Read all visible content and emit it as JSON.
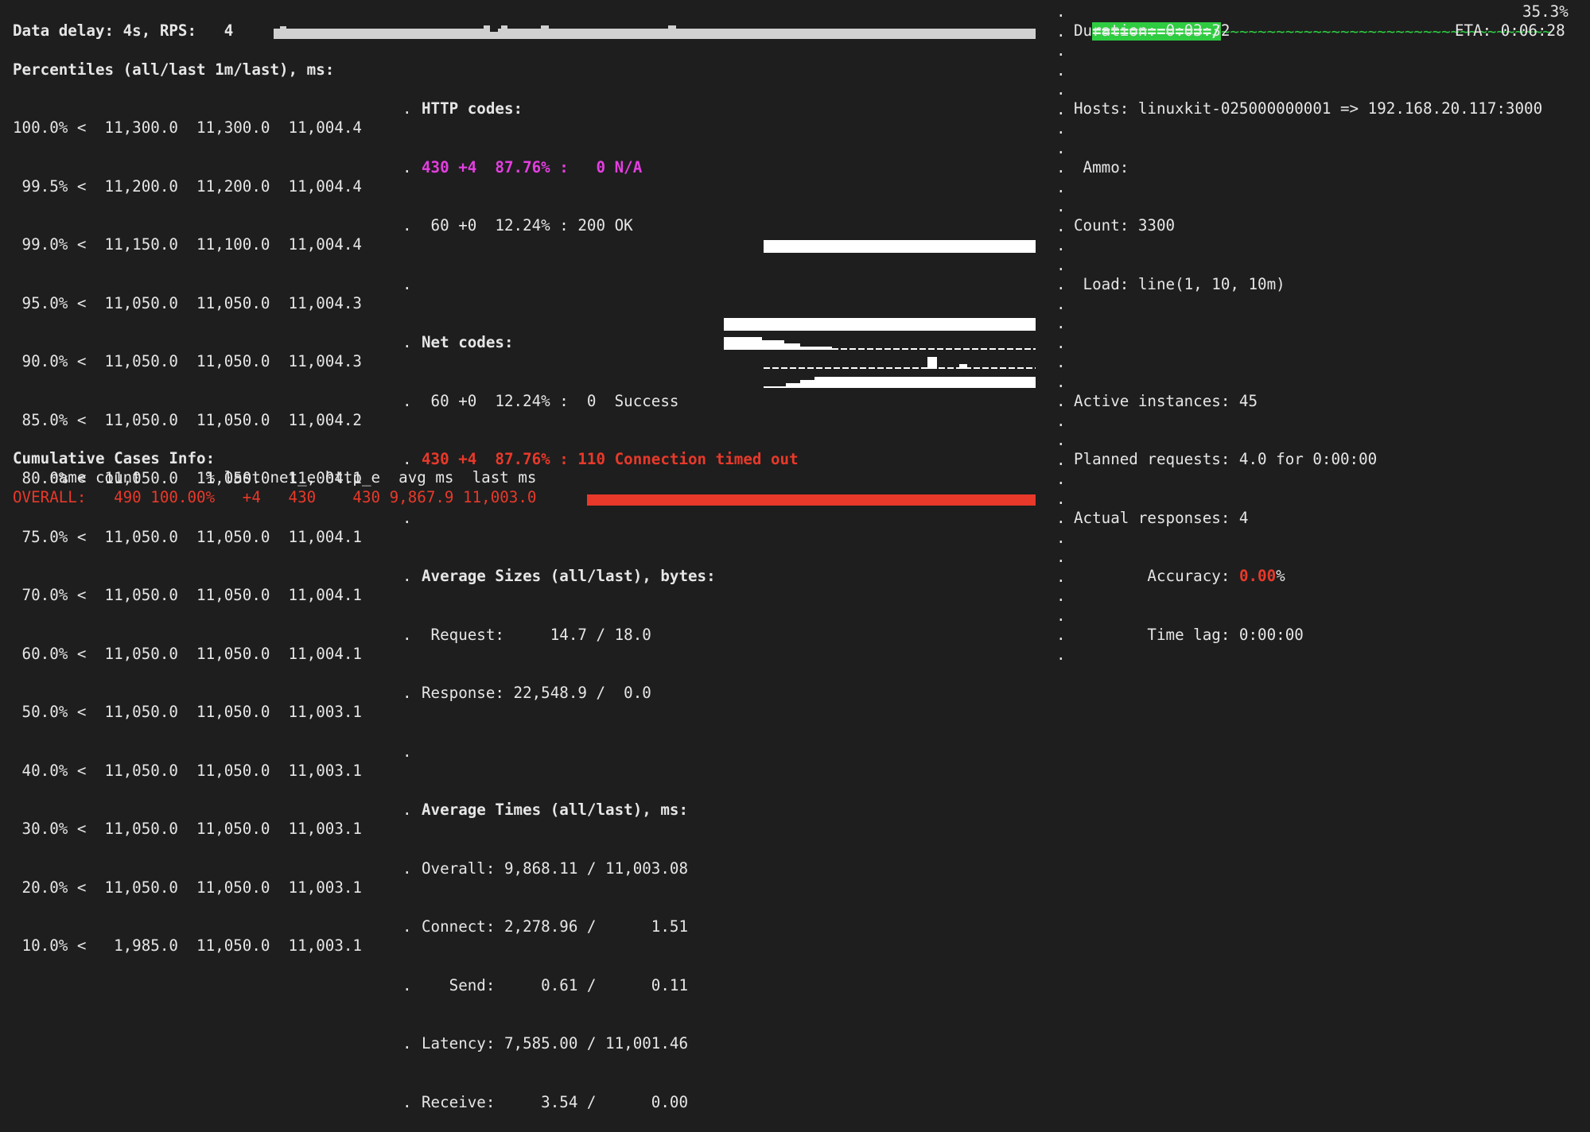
{
  "header": {
    "data_delay_line": "Data delay: 4s, RPS:   4"
  },
  "percentiles": {
    "title": "Percentiles (all/last 1m/last), ms:",
    "rows": [
      "100.0% <  11,300.0  11,300.0  11,004.4",
      " 99.5% <  11,200.0  11,200.0  11,004.4",
      " 99.0% <  11,150.0  11,100.0  11,004.4",
      " 95.0% <  11,050.0  11,050.0  11,004.3",
      " 90.0% <  11,050.0  11,050.0  11,004.3",
      " 85.0% <  11,050.0  11,050.0  11,004.2",
      " 80.0% <  11,050.0  11,050.0  11,004.1",
      " 75.0% <  11,050.0  11,050.0  11,004.1",
      " 70.0% <  11,050.0  11,050.0  11,004.1",
      " 60.0% <  11,050.0  11,050.0  11,004.1",
      " 50.0% <  11,050.0  11,050.0  11,003.1",
      " 40.0% <  11,050.0  11,050.0  11,003.1",
      " 30.0% <  11,050.0  11,050.0  11,003.1",
      " 20.0% <  11,050.0  11,050.0  11,003.1",
      " 10.0% <   1,985.0  11,050.0  11,003.1"
    ]
  },
  "http_codes": {
    "title": "HTTP codes:",
    "row1": "430 +4  87.76% :   0 N/A",
    "row2": " 60 +0  12.24% : 200 OK"
  },
  "net_codes": {
    "title": "Net codes:",
    "row1": " 60 +0  12.24% :  0  Success",
    "row2": "430 +4  87.76% : 110 Connection timed out"
  },
  "avg_sizes": {
    "title": "Average Sizes (all/last), bytes:",
    "request": " Request:     14.7 / 18.0",
    "response": "Response: 22,548.9 /  0.0"
  },
  "avg_times": {
    "title": "Average Times (all/last), ms:",
    "overall": "Overall: 9,868.11 / 11,003.08",
    "connect": "Connect: 2,278.96 /      1.51",
    "send": "   Send:     0.61 /      0.11",
    "latency": "Latency: 7,585.00 / 11,001.46",
    "receive": "Receive:     3.54 /      0.00"
  },
  "cases": {
    "title": "Cumulative Cases Info:",
    "header": "    name count       % last net_e http_e  avg ms  last ms",
    "overall": "OVERALL:   490 100.00%   +4   430    430 9,867.9 11,003.0"
  },
  "right": {
    "progress_bar": "=============/",
    "progress_tail": "~~~~~~~~~~~~~~~~~~~~~~~~~~~~~~~~~~~~",
    "progress_percent": "35.3%",
    "progress_value": 0.353,
    "duration": "Duration: 0:03:32",
    "eta": "ETA: 0:06:28",
    "hosts": "Hosts: linuxkit-025000000001 => 192.168.20.117:3000",
    "ammo": " Ammo:",
    "count": "Count: 3300",
    "load": " Load: line(1, 10, 10m)",
    "active_instances": "Active instances: 45",
    "planned_requests": "Planned requests: 4.0 for 0:00:00",
    "actual_responses": "Actual responses: 4",
    "accuracy_label": "        Accuracy: ",
    "accuracy_value": "0.00",
    "accuracy_unit": "%",
    "time_lag": "        Time lag: 0:00:00"
  },
  "separator_dot": ".",
  "colors": {
    "background": "#1e1e1e",
    "text": "#e6e6e6",
    "red": "#e8392a",
    "magenta": "#e33fe0",
    "green": "#2ecc40"
  }
}
